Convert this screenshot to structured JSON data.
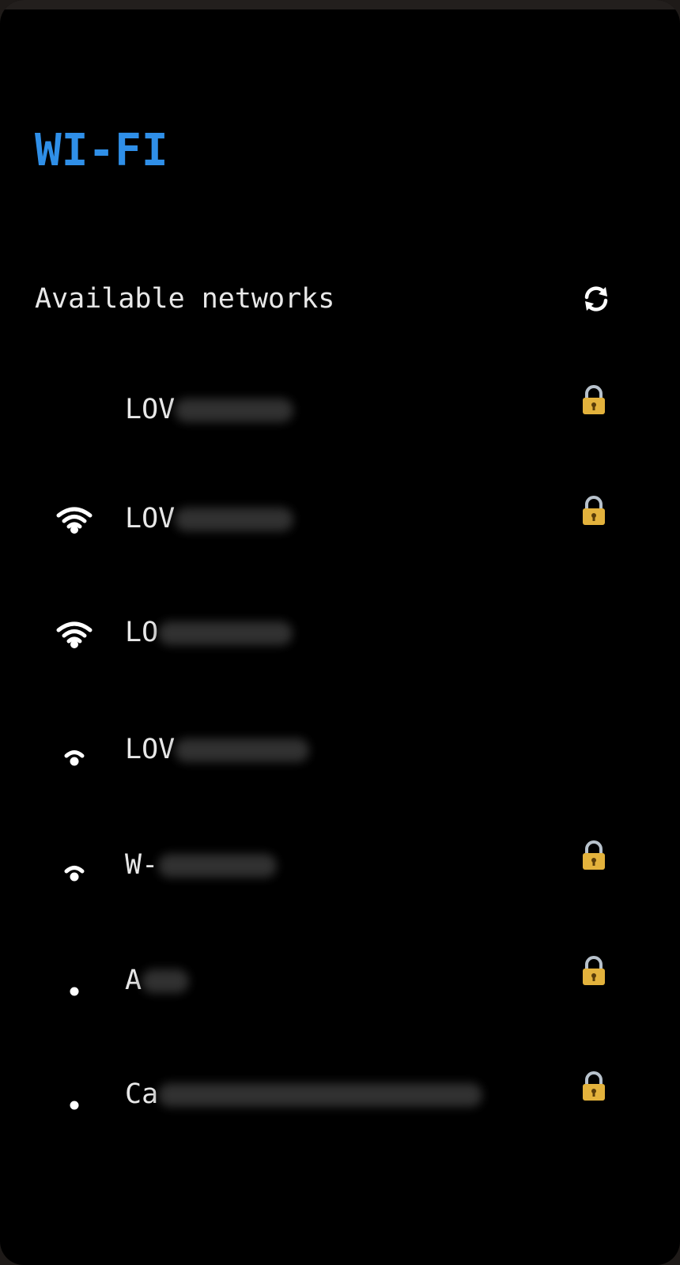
{
  "app": {
    "title": "WI-FI"
  },
  "section": {
    "label": "Available networks",
    "refresh_icon": "refresh-icon"
  },
  "colors": {
    "title_accent": "#2f8fe8",
    "text": "#e8e8e8",
    "background": "#000000",
    "lock_body": "#e3b23c"
  },
  "networks": [
    {
      "name_visible": "LOV",
      "secured": true,
      "signal_bars": 0
    },
    {
      "name_visible": "LOV",
      "secured": true,
      "signal_bars": 3
    },
    {
      "name_visible": "LO",
      "secured": false,
      "signal_bars": 3
    },
    {
      "name_visible": "LOV",
      "secured": false,
      "signal_bars": 2
    },
    {
      "name_visible": "W-",
      "secured": true,
      "signal_bars": 2
    },
    {
      "name_visible": "A",
      "secured": true,
      "signal_bars": 1
    },
    {
      "name_visible": "Ca",
      "secured": true,
      "signal_bars": 1
    }
  ]
}
